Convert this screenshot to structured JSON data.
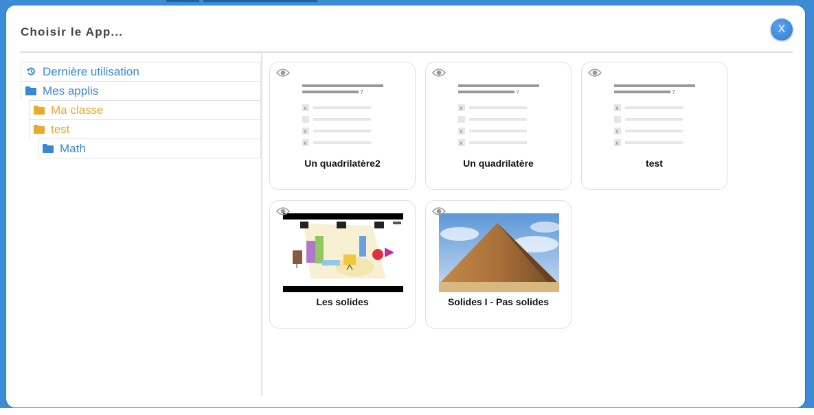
{
  "dialog": {
    "title": "Choisir le App...",
    "close_label": "X"
  },
  "tree": [
    {
      "label": "Dernière utilisation",
      "icon": "history-icon",
      "color": "#3a87d6"
    },
    {
      "label": "Mes applis",
      "icon": "folder-icon",
      "color": "#3a87d6"
    },
    {
      "label": "Ma classe",
      "icon": "folder-icon",
      "color": "#e8a92c"
    },
    {
      "label": "test",
      "icon": "folder-icon",
      "color": "#e8a92c"
    },
    {
      "label": "Math",
      "icon": "folder-icon",
      "color": "#3a87d6"
    }
  ],
  "apps": [
    {
      "name": "Un quadrilatère2",
      "thumbnail": "quiz-placeholder"
    },
    {
      "name": "Un quadrilatère",
      "thumbnail": "quiz-placeholder"
    },
    {
      "name": "test",
      "thumbnail": "quiz-placeholder"
    },
    {
      "name": "Les solides",
      "thumbnail": "solids-video-still"
    },
    {
      "name": "Solides I - Pas solides",
      "thumbnail": "pyramid-photo"
    }
  ],
  "colors": {
    "accent": "#3a87d6",
    "folder_orange": "#e8a92c",
    "backdrop": "#3d8ad6"
  }
}
